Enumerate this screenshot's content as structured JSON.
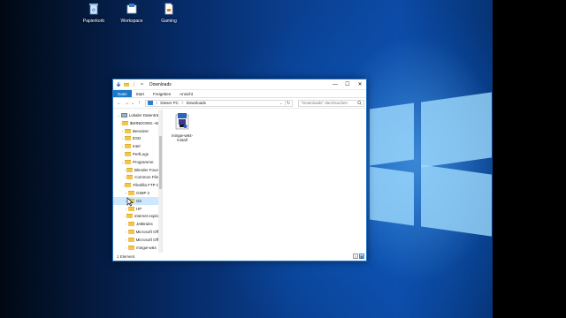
{
  "desktop": {
    "icons": [
      {
        "label": "Papierkorb",
        "icon": "recycle-bin-icon"
      },
      {
        "label": "Workspace",
        "icon": "workspace-icon"
      },
      {
        "label": "Gaming",
        "icon": "file-icon"
      }
    ]
  },
  "window": {
    "title": "Downloads",
    "quick_access_sep": "|",
    "quick_access_more": "=",
    "controls": {
      "minimize": "—",
      "maximize": "☐",
      "close": "✕"
    },
    "ribbon_tabs": [
      "Datei",
      "Start",
      "Freigeben",
      "Ansicht"
    ],
    "address": {
      "root": "Dieser PC",
      "sep": ">",
      "current": "Downloads",
      "dropdown": "⌄",
      "refresh": "↻"
    },
    "search_placeholder": "\"Downloads\" durchsuchen",
    "nav": {
      "back": "←",
      "forward": "→",
      "recent": "⌄",
      "up": "↑"
    },
    "tree": [
      {
        "label": "Lokaler Datenträ",
        "indent": 0,
        "arrow": "⌄",
        "kind": "drive"
      },
      {
        "label": "$WINDOWS.~B",
        "indent": 1,
        "arrow": "›",
        "kind": "folder"
      },
      {
        "label": "Benutzer",
        "indent": 1,
        "arrow": "›",
        "kind": "folder"
      },
      {
        "label": "ESD",
        "indent": 1,
        "arrow": "›",
        "kind": "folder"
      },
      {
        "label": "Intel",
        "indent": 1,
        "arrow": "›",
        "kind": "folder"
      },
      {
        "label": "PerfLogs",
        "indent": 1,
        "arrow": "",
        "kind": "folder"
      },
      {
        "label": "Programme",
        "indent": 1,
        "arrow": "⌄",
        "kind": "folder"
      },
      {
        "label": "Blender Foun",
        "indent": 2,
        "arrow": "›",
        "kind": "folder"
      },
      {
        "label": "Common File",
        "indent": 2,
        "arrow": "›",
        "kind": "folder"
      },
      {
        "label": "FileZilla FTP C",
        "indent": 2,
        "arrow": "›",
        "kind": "folder"
      },
      {
        "label": "GIMP 2",
        "indent": 2,
        "arrow": "›",
        "kind": "folder"
      },
      {
        "label": "Git",
        "indent": 2,
        "arrow": "›",
        "kind": "folder",
        "selected": true
      },
      {
        "label": "HP",
        "indent": 2,
        "arrow": "›",
        "kind": "folder"
      },
      {
        "label": "internet explo",
        "indent": 2,
        "arrow": "›",
        "kind": "folder"
      },
      {
        "label": "JetBrains",
        "indent": 2,
        "arrow": "›",
        "kind": "folder"
      },
      {
        "label": "Microsoft Off",
        "indent": 2,
        "arrow": "›",
        "kind": "folder"
      },
      {
        "label": "Microsoft Off",
        "indent": 2,
        "arrow": "›",
        "kind": "folder"
      },
      {
        "label": "mingw-w64",
        "indent": 2,
        "arrow": "›",
        "kind": "folder"
      },
      {
        "label": "NVIDIA Corpo",
        "indent": 2,
        "arrow": "›",
        "kind": "folder"
      }
    ],
    "files": [
      {
        "name": "mingw-w64-install",
        "icon": "installer-icon"
      }
    ],
    "status": "1 Element",
    "view_buttons": [
      "details-view-icon",
      "large-icons-view-icon"
    ]
  },
  "colors": {
    "accent": "#1979ca",
    "folder": "#f3c54f",
    "selection": "#cce8ff"
  }
}
